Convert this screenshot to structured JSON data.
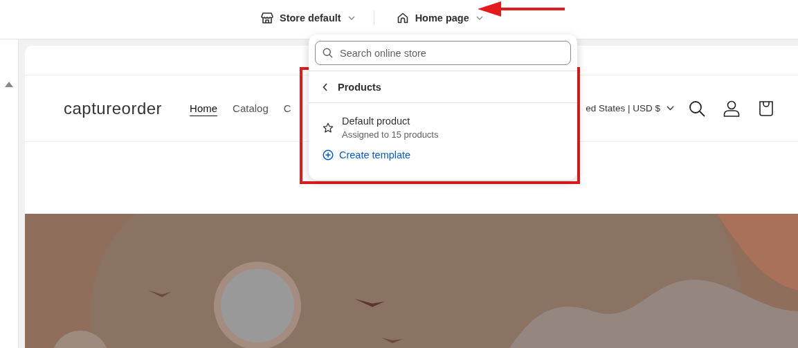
{
  "toolbar": {
    "theme_selector": {
      "label": "Store default"
    },
    "page_selector": {
      "label": "Home page"
    }
  },
  "preview": {
    "logo": "captureorder",
    "nav": [
      {
        "label": "Home",
        "selected": true
      },
      {
        "label": "Catalog",
        "selected": false
      },
      {
        "label": "C",
        "selected": false
      }
    ],
    "country": "ed States | USD $"
  },
  "dropdown": {
    "search": {
      "placeholder": "Search online store"
    },
    "section": "Products",
    "templates": [
      {
        "name": "Default product",
        "detail": "Assigned to 15 products"
      }
    ],
    "create": "Create template"
  }
}
